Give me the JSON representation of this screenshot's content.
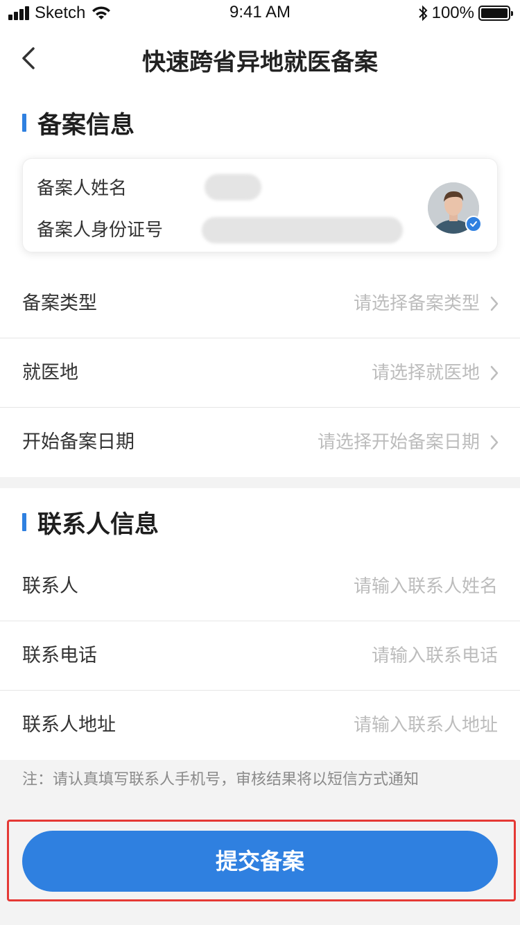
{
  "status_bar": {
    "carrier": "Sketch",
    "time": "9:41 AM",
    "battery": "100%"
  },
  "nav": {
    "title": "快速跨省异地就医备案"
  },
  "filing_section": {
    "title": "备案信息",
    "card": {
      "name_label": "备案人姓名",
      "id_label": "备案人身份证号"
    },
    "rows": [
      {
        "label": "备案类型",
        "placeholder": "请选择备案类型"
      },
      {
        "label": "就医地",
        "placeholder": "请选择就医地"
      },
      {
        "label": "开始备案日期",
        "placeholder": "请选择开始备案日期"
      }
    ]
  },
  "contact_section": {
    "title": "联系人信息",
    "rows": [
      {
        "label": "联系人",
        "placeholder": "请输入联系人姓名"
      },
      {
        "label": "联系电话",
        "placeholder": "请输入联系电话"
      },
      {
        "label": "联系人地址",
        "placeholder": "请输入联系人地址"
      }
    ]
  },
  "note": "注：请认真填写联系人手机号，审核结果将以短信方式通知",
  "submit_label": "提交备案",
  "colors": {
    "accent": "#2f80e0",
    "highlight": "#e53935",
    "placeholder": "#bcbcbc"
  }
}
